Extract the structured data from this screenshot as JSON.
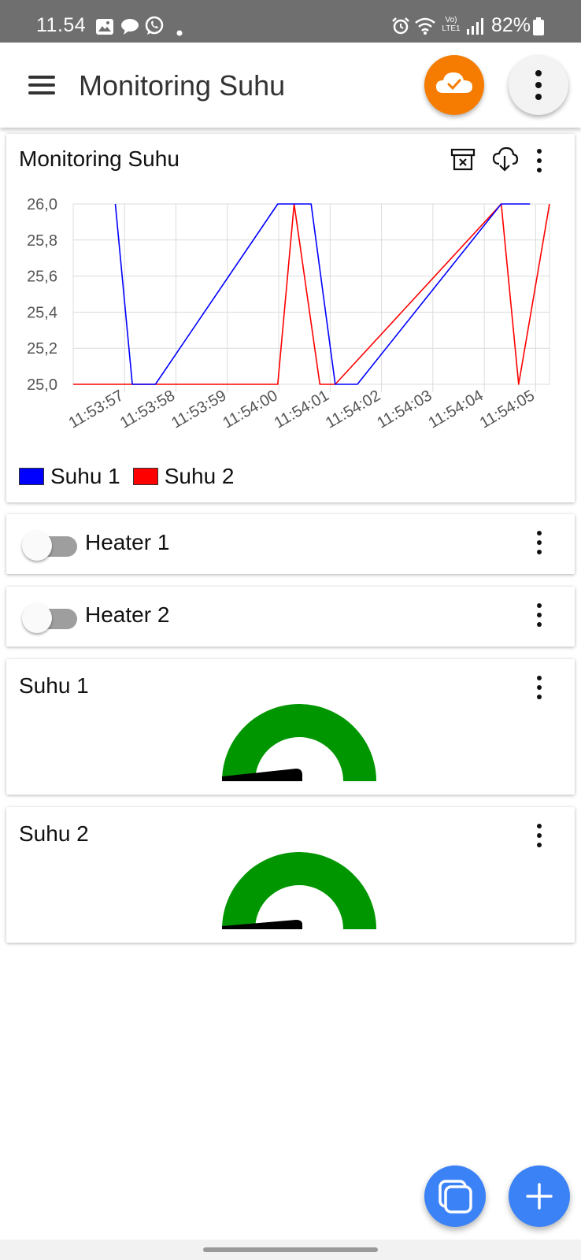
{
  "status_bar": {
    "time": "11.54",
    "battery": "82%",
    "network": "Vo) LTE1",
    "icons": [
      "gallery-icon",
      "chat-bubble-icon",
      "whatsapp-icon",
      "dot-icon",
      "alarm-icon",
      "wifi-icon",
      "signal-icon",
      "battery-icon"
    ]
  },
  "app_bar": {
    "title": "Monitoring Suhu",
    "icons": [
      "menu-icon",
      "cloud-check-icon",
      "more-vert-icon"
    ],
    "cloud_button_color": "#f57c00"
  },
  "chart_widget": {
    "title": "Monitoring Suhu",
    "icons": [
      "clear-data-icon",
      "cloud-download-icon",
      "more-vert-icon"
    ]
  },
  "chart_data": {
    "type": "line",
    "title": "Monitoring Suhu",
    "xlabel": "",
    "ylabel": "",
    "x_ticks": [
      "11:53:57",
      "11:53:58",
      "11:53:59",
      "11:54:00",
      "11:54:01",
      "11:54:02",
      "11:54:03",
      "11:54:04",
      "11:54:05"
    ],
    "y_ticks": [
      "26,0",
      "25,8",
      "25,6",
      "25,4",
      "25,2",
      "25,0"
    ],
    "ylim": [
      25.0,
      26.0
    ],
    "xlim_seconds_after_11_53_56": [
      0.0,
      9.27
    ],
    "grid": true,
    "legend_position": "bottom-left",
    "series": [
      {
        "name": "Suhu 1",
        "color": "#0000ff",
        "points": [
          [
            0.82,
            26.0
          ],
          [
            1.15,
            25.0
          ],
          [
            1.6,
            25.0
          ],
          [
            3.98,
            26.0
          ],
          [
            4.63,
            26.0
          ],
          [
            5.1,
            25.0
          ],
          [
            5.53,
            25.0
          ],
          [
            8.33,
            26.0
          ],
          [
            8.89,
            26.0
          ]
        ]
      },
      {
        "name": "Suhu 2",
        "color": "#ff0000",
        "points": [
          [
            0.0,
            25.0
          ],
          [
            3.98,
            25.0
          ],
          [
            4.3,
            26.0
          ],
          [
            4.8,
            25.0
          ],
          [
            5.1,
            25.0
          ],
          [
            8.33,
            26.0
          ],
          [
            8.67,
            25.0
          ],
          [
            9.27,
            26.0
          ]
        ]
      }
    ]
  },
  "heater_1": {
    "label": "Heater 1",
    "on": false
  },
  "heater_2": {
    "label": "Heater 2",
    "on": false
  },
  "gauge_1": {
    "title": "Suhu 1",
    "color": "#009600"
  },
  "gauge_2": {
    "title": "Suhu 2",
    "color": "#009600"
  },
  "fabs": {
    "icons": [
      "copy-widgets-icon",
      "add-icon"
    ],
    "color": "#3b82f6"
  }
}
